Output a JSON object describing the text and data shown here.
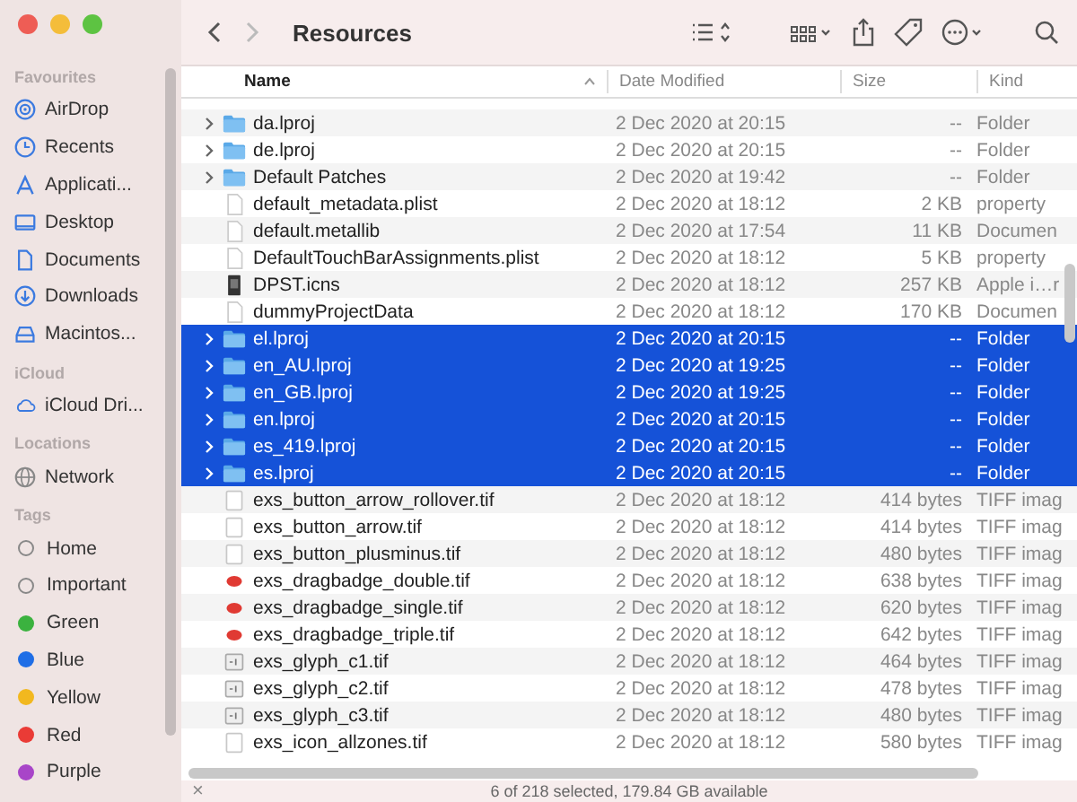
{
  "window": {
    "title": "Resources"
  },
  "sidebar": {
    "sections": [
      {
        "heading": "Favourites",
        "items": [
          {
            "label": "AirDrop",
            "kind": "airdrop"
          },
          {
            "label": "Recents",
            "kind": "recents"
          },
          {
            "label": "Applicati...",
            "kind": "applications"
          },
          {
            "label": "Desktop",
            "kind": "desktop"
          },
          {
            "label": "Documents",
            "kind": "documents"
          },
          {
            "label": "Downloads",
            "kind": "downloads"
          },
          {
            "label": "Macintos...",
            "kind": "drive"
          }
        ]
      },
      {
        "heading": "iCloud",
        "items": [
          {
            "label": "iCloud Dri...",
            "kind": "cloud"
          }
        ]
      },
      {
        "heading": "Locations",
        "items": [
          {
            "label": "Network",
            "kind": "network"
          }
        ]
      },
      {
        "heading": "Tags",
        "items": [
          {
            "label": "Home",
            "kind": "tag"
          },
          {
            "label": "Important",
            "kind": "tag"
          },
          {
            "label": "Green",
            "kind": "tag",
            "color": "#3bb23f"
          },
          {
            "label": "Blue",
            "kind": "tag",
            "color": "#1f6ee6"
          },
          {
            "label": "Yellow",
            "kind": "tag",
            "color": "#f2b81f"
          },
          {
            "label": "Red",
            "kind": "tag",
            "color": "#ea3b36"
          },
          {
            "label": "Purple",
            "kind": "tag",
            "color": "#a845c8"
          }
        ]
      }
    ]
  },
  "table": {
    "columns": [
      {
        "label": "Name",
        "sorted": true
      },
      {
        "label": "Date Modified",
        "sorted": false
      },
      {
        "label": "Size",
        "sorted": false
      },
      {
        "label": "Kind",
        "sorted": false
      }
    ],
    "rows": [
      {
        "kind": "folder",
        "name": "da.lproj",
        "date": "2 Dec 2020 at 20:15",
        "size": "--",
        "type": "Folder",
        "selected": false
      },
      {
        "kind": "folder",
        "name": "de.lproj",
        "date": "2 Dec 2020 at 20:15",
        "size": "--",
        "type": "Folder",
        "selected": false
      },
      {
        "kind": "folder",
        "name": "Default Patches",
        "date": "2 Dec 2020 at 19:42",
        "size": "--",
        "type": "Folder",
        "selected": false
      },
      {
        "kind": "document",
        "name": "default_metadata.plist",
        "date": "2 Dec 2020 at 18:12",
        "size": "2 KB",
        "type": "property",
        "selected": false
      },
      {
        "kind": "document",
        "name": "default.metallib",
        "date": "2 Dec 2020 at 17:54",
        "size": "11 KB",
        "type": "Documen",
        "selected": false
      },
      {
        "kind": "document",
        "name": "DefaultTouchBarAssignments.plist",
        "date": "2 Dec 2020 at 18:12",
        "size": "5 KB",
        "type": "property",
        "selected": false
      },
      {
        "kind": "dark",
        "name": "DPST.icns",
        "date": "2 Dec 2020 at 18:12",
        "size": "257 KB",
        "type": "Apple i…r",
        "selected": false
      },
      {
        "kind": "document",
        "name": "dummyProjectData",
        "date": "2 Dec 2020 at 18:12",
        "size": "170 KB",
        "type": "Documen",
        "selected": false
      },
      {
        "kind": "folder",
        "name": "el.lproj",
        "date": "2 Dec 2020 at 20:15",
        "size": "--",
        "type": "Folder",
        "selected": true
      },
      {
        "kind": "folder",
        "name": "en_AU.lproj",
        "date": "2 Dec 2020 at 19:25",
        "size": "--",
        "type": "Folder",
        "selected": true
      },
      {
        "kind": "folder",
        "name": "en_GB.lproj",
        "date": "2 Dec 2020 at 19:25",
        "size": "--",
        "type": "Folder",
        "selected": true
      },
      {
        "kind": "folder",
        "name": "en.lproj",
        "date": "2 Dec 2020 at 20:15",
        "size": "--",
        "type": "Folder",
        "selected": true
      },
      {
        "kind": "folder",
        "name": "es_419.lproj",
        "date": "2 Dec 2020 at 20:15",
        "size": "--",
        "type": "Folder",
        "selected": true
      },
      {
        "kind": "folder",
        "name": "es.lproj",
        "date": "2 Dec 2020 at 20:15",
        "size": "--",
        "type": "Folder",
        "selected": true
      },
      {
        "kind": "image",
        "name": "exs_button_arrow_rollover.tif",
        "date": "2 Dec 2020 at 18:12",
        "size": "414 bytes",
        "type": "TIFF imag",
        "selected": false
      },
      {
        "kind": "image",
        "name": "exs_button_arrow.tif",
        "date": "2 Dec 2020 at 18:12",
        "size": "414 bytes",
        "type": "TIFF imag",
        "selected": false
      },
      {
        "kind": "image",
        "name": "exs_button_plusminus.tif",
        "date": "2 Dec 2020 at 18:12",
        "size": "480 bytes",
        "type": "TIFF imag",
        "selected": false
      },
      {
        "kind": "badge",
        "name": "exs_dragbadge_double.tif",
        "date": "2 Dec 2020 at 18:12",
        "size": "638 bytes",
        "type": "TIFF imag",
        "selected": false
      },
      {
        "kind": "badge",
        "name": "exs_dragbadge_single.tif",
        "date": "2 Dec 2020 at 18:12",
        "size": "620 bytes",
        "type": "TIFF imag",
        "selected": false
      },
      {
        "kind": "badge",
        "name": "exs_dragbadge_triple.tif",
        "date": "2 Dec 2020 at 18:12",
        "size": "642 bytes",
        "type": "TIFF imag",
        "selected": false
      },
      {
        "kind": "glyph",
        "name": "exs_glyph_c1.tif",
        "date": "2 Dec 2020 at 18:12",
        "size": "464 bytes",
        "type": "TIFF imag",
        "selected": false
      },
      {
        "kind": "glyph",
        "name": "exs_glyph_c2.tif",
        "date": "2 Dec 2020 at 18:12",
        "size": "478 bytes",
        "type": "TIFF imag",
        "selected": false
      },
      {
        "kind": "glyph",
        "name": "exs_glyph_c3.tif",
        "date": "2 Dec 2020 at 18:12",
        "size": "480 bytes",
        "type": "TIFF imag",
        "selected": false
      },
      {
        "kind": "image",
        "name": "exs_icon_allzones.tif",
        "date": "2 Dec 2020 at 18:12",
        "size": "580 bytes",
        "type": "TIFF imag",
        "selected": false
      }
    ]
  },
  "status_bar": {
    "close": "×",
    "text": "6 of 218 selected, 179.84 GB available"
  }
}
